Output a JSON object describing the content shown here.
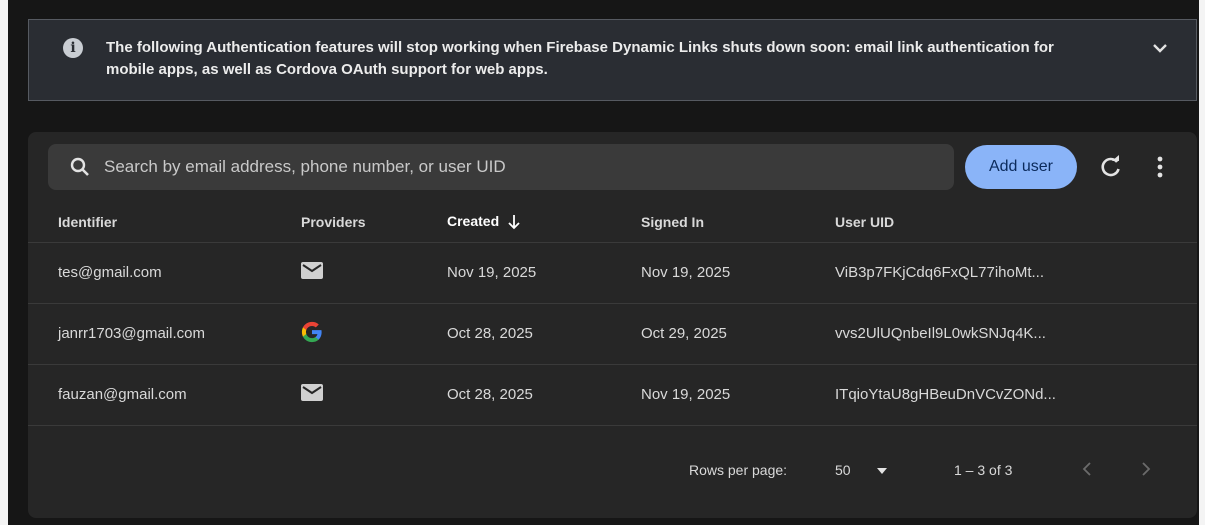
{
  "banner": {
    "message": "The following Authentication features will stop working when Firebase Dynamic Links shuts down soon: email link authentication for mobile apps, as well as Cordova OAuth support for web apps."
  },
  "search": {
    "placeholder": "Search by email address, phone number, or user UID"
  },
  "toolbar": {
    "add_user_label": "Add user"
  },
  "table": {
    "headers": {
      "identifier": "Identifier",
      "providers": "Providers",
      "created": "Created",
      "signed_in": "Signed In",
      "user_uid": "User UID"
    },
    "rows": [
      {
        "identifier": "tes@gmail.com",
        "provider": "email-icon",
        "created": "Nov 19, 2025",
        "signed_in": "Nov 19, 2025",
        "uid": "ViB3p7FKjCdq6FxQL77ihoMt..."
      },
      {
        "identifier": "janrr1703@gmail.com",
        "provider": "google-icon",
        "created": "Oct 28, 2025",
        "signed_in": "Oct 29, 2025",
        "uid": "vvs2UlUQnbeIl9L0wkSNJq4K..."
      },
      {
        "identifier": "fauzan@gmail.com",
        "provider": "email-icon",
        "created": "Oct 28, 2025",
        "signed_in": "Nov 19, 2025",
        "uid": "ITqioYtaU8gHBeuDnVCvZONd..."
      }
    ]
  },
  "pagination": {
    "rows_per_page_label": "Rows per page:",
    "rows_per_page_value": "50",
    "range": "1 – 3 of 3"
  },
  "colors": {
    "primary_button": "#8ab4f8",
    "background": "#161616",
    "card": "#262626",
    "banner": "#2a2d33"
  }
}
